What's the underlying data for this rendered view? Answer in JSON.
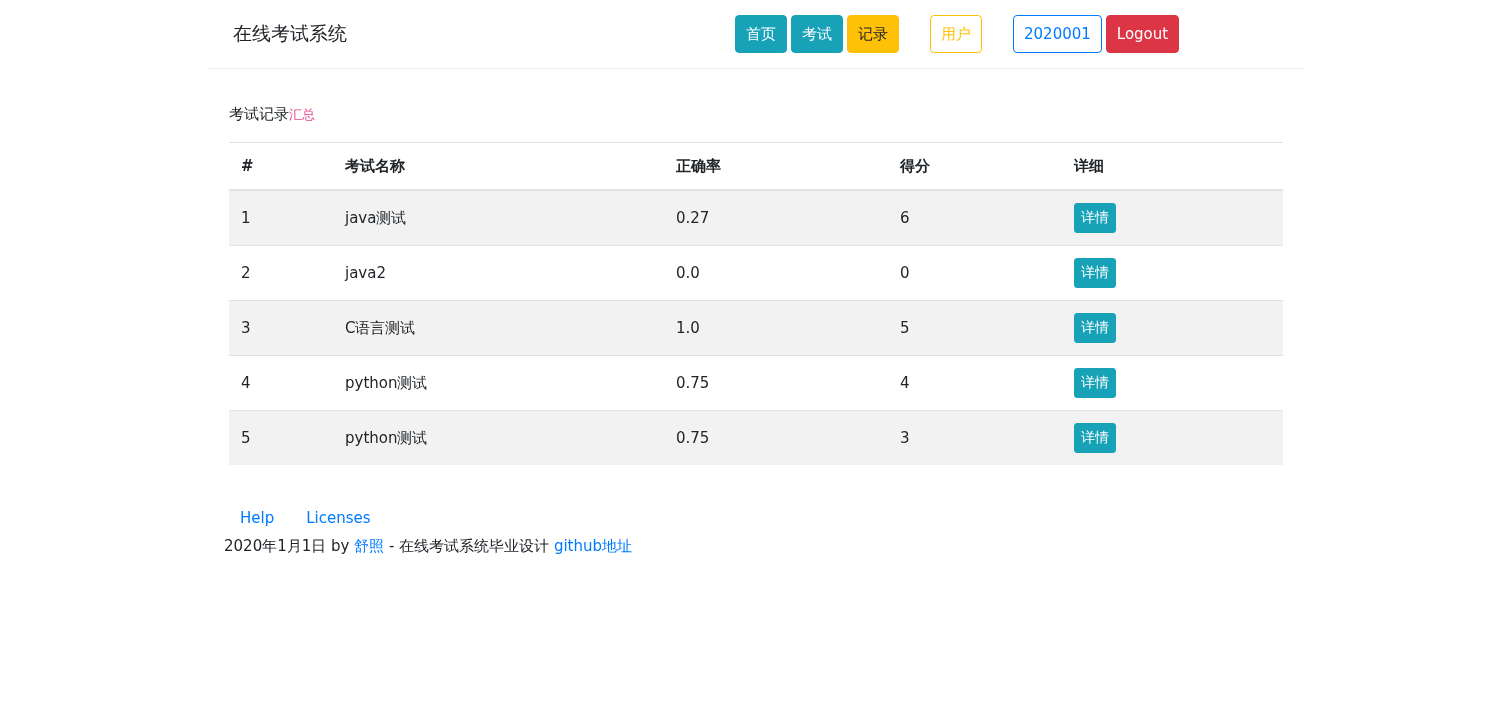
{
  "header": {
    "brand": "在线考试系统",
    "nav": [
      {
        "label": "首页",
        "kind": "page"
      },
      {
        "label": "考试",
        "kind": "page"
      },
      {
        "label": "记录",
        "kind": "current"
      },
      {
        "label": "用户",
        "kind": "account"
      },
      {
        "label": "2020001",
        "kind": "userid"
      },
      {
        "label": "Logout",
        "kind": "logout"
      }
    ]
  },
  "heading": {
    "title": "考试记录",
    "suffix": "汇总"
  },
  "table": {
    "columns": [
      "#",
      "考试名称",
      "正确率",
      "得分",
      "详细"
    ],
    "rows": [
      {
        "cells": [
          "1",
          "java测试",
          "0.27",
          "6"
        ],
        "action": "详情"
      },
      {
        "cells": [
          "2",
          "java2",
          "0.0",
          "0"
        ],
        "action": "详情"
      },
      {
        "cells": [
          "3",
          "C语言测试",
          "1.0",
          "5"
        ],
        "action": "详情"
      },
      {
        "cells": [
          "4",
          "python测试",
          "0.75",
          "4"
        ],
        "action": "详情"
      },
      {
        "cells": [
          "5",
          "python测试",
          "0.75",
          "3"
        ],
        "action": "详情"
      }
    ]
  },
  "footer": {
    "links": [
      "Help",
      "Licenses"
    ],
    "credit": {
      "date_by": "2020年1月1日 by ",
      "author": "舒照",
      "middle": " - 在线考试系统毕业设计 ",
      "repo": "github地址"
    }
  }
}
